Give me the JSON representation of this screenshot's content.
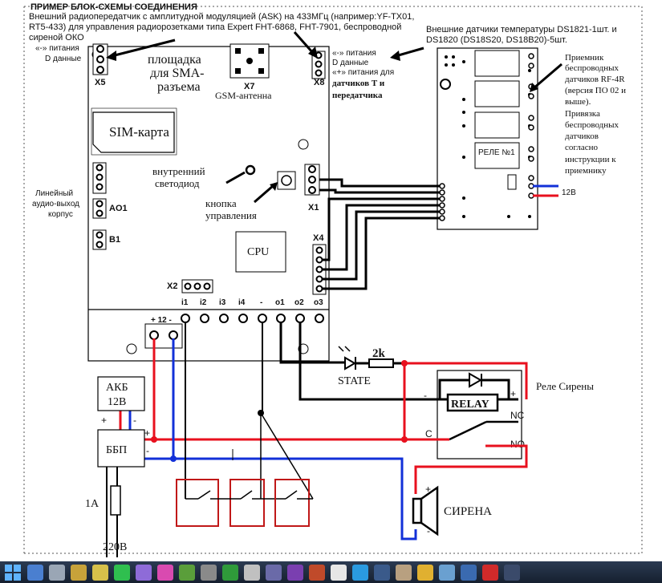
{
  "top_title": "ПРИМЕР БЛОК-СХЕМЫ СОЕДИНЕНИЯ",
  "header_text": [
    "Внешний радиопередатчик с амплитудной модуляцией (ASK) на 433МГц (например:YF-TX01,",
    "RT5-433) для управления радиорозетками типа Expert FHT-6868, FHT-7901,  беспроводной",
    "сиреной ОКО"
  ],
  "sensors_text": [
    "Внешние датчики температуры DS1821-1шт. и",
    "DS1820 (DS18S20, DS18B20)-5шт."
  ],
  "left_labels": {
    "x5_lines": [
      "«-» питания",
      "D данные"
    ],
    "x5": "X5",
    "line_out": [
      "Линейный",
      "аудио-выход",
      "корпус"
    ],
    "ao1": "AO1",
    "b1": "B1"
  },
  "board": {
    "sma_label": [
      "площадка",
      "для SMA-",
      "разъема"
    ],
    "x7": "X7",
    "gsm_antenna": "GSM-антенна",
    "x8": "X8",
    "sim_card": "SIM-карта",
    "internal_led": [
      "внутренний",
      "светодиод"
    ],
    "control_button": [
      "кнопка",
      "управления"
    ],
    "x1": "X1",
    "cpu": "CPU",
    "x4": "X4",
    "x2": "X2",
    "terminals": [
      "i1",
      "i2",
      "i3",
      "i4",
      "-",
      "o1",
      "o2",
      "o3"
    ],
    "power_term": "+ 12 -"
  },
  "x8_labels": {
    "lines": [
      "«-» питания",
      "D данные"
    ],
    "bold_lines": [
      "«+» питания для",
      "датчиков Т и",
      "передатчика"
    ]
  },
  "receiver": {
    "relay_label": "РЕЛЕ №1",
    "description": [
      "Приемник",
      "беспроводных",
      "датчиков RF-4R",
      "(версия ПО 02 и",
      "выше).",
      "Привязка",
      "беспроводных",
      "датчиков",
      "согласно",
      "инструкции к",
      "приемнику"
    ],
    "supply_label": "12В"
  },
  "power": {
    "battery": [
      "АКБ",
      "12В"
    ],
    "psu": "ББП",
    "fuse": "1А",
    "mains": "220В",
    "plus": "+",
    "minus": "-"
  },
  "siren_circuit": {
    "state": "STATE",
    "resistor": "2k",
    "relay": "RELAY",
    "relay_title": "Реле Сирены",
    "nc": "NC",
    "no": "NO",
    "c": "C",
    "siren": "СИРЕНА",
    "plus": "+",
    "minus": "-"
  },
  "colors": {
    "red_wire": "#e8101e",
    "blue_wire": "#1230d8",
    "black_wire": "#000000",
    "switch_box": "#c01818",
    "taskbar": "#1d2a3e"
  },
  "taskbar_icons": [
    {
      "name": "start-icon",
      "color": "#5fb3ff"
    },
    {
      "name": "explorer-icon",
      "color": "#4a7fd0"
    },
    {
      "name": "computer-icon",
      "color": "#9aa6b5"
    },
    {
      "name": "tools-icon",
      "color": "#c7a23a"
    },
    {
      "name": "palette-icon",
      "color": "#d6c04a"
    },
    {
      "name": "flag-icon",
      "color": "#2fbf4f"
    },
    {
      "name": "prism-icon",
      "color": "#8e6bd8"
    },
    {
      "name": "paint-icon",
      "color": "#d94ab0"
    },
    {
      "name": "minecraft-icon",
      "color": "#5a9e3a"
    },
    {
      "name": "3d-icon",
      "color": "#8a8a8a"
    },
    {
      "name": "xbox-icon",
      "color": "#2f9a3a"
    },
    {
      "name": "puzzle-icon",
      "color": "#c0c0c0"
    },
    {
      "name": "chip-icon",
      "color": "#6a6aa8"
    },
    {
      "name": "media-icon",
      "color": "#7a3fb0"
    },
    {
      "name": "photo-icon",
      "color": "#c04a2a"
    },
    {
      "name": "cursor-icon",
      "color": "#e6e6e6"
    },
    {
      "name": "skype-icon",
      "color": "#2a9ae0"
    },
    {
      "name": "steam-icon",
      "color": "#3a5a8a"
    },
    {
      "name": "app-icon",
      "color": "#b8a080"
    },
    {
      "name": "chrome-icon",
      "color": "#e0b030"
    },
    {
      "name": "settings-icon",
      "color": "#6aa0d0"
    },
    {
      "name": "vk-icon",
      "color": "#3a6ab0"
    },
    {
      "name": "opera-icon",
      "color": "#d02a2a"
    },
    {
      "name": "folder-icon",
      "color": "#3a4a6a"
    }
  ]
}
